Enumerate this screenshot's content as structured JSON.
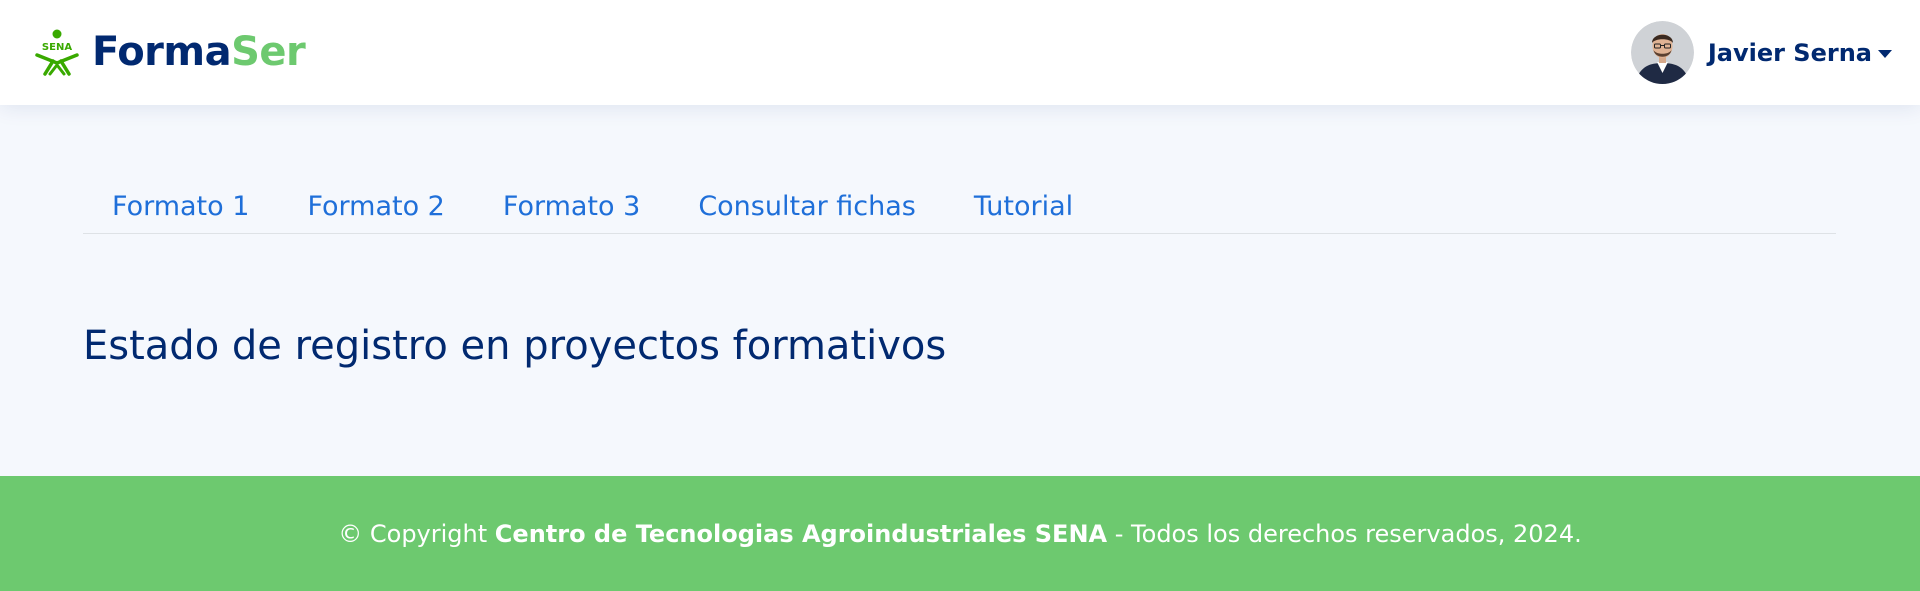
{
  "header": {
    "logo": {
      "mark_text": "SENA",
      "brand_part1": "Forma",
      "brand_part2": "Ser",
      "color_primary": "#012970",
      "color_accent": "#6dc96f",
      "icon": "sena-logo-icon"
    },
    "user": {
      "name": "Javier Serna",
      "avatar_icon": "user-avatar",
      "dropdown_icon": "caret-down-icon"
    }
  },
  "tabs": [
    {
      "label": "Formato 1"
    },
    {
      "label": "Formato 2"
    },
    {
      "label": "Formato 3"
    },
    {
      "label": "Consultar fichas"
    },
    {
      "label": "Tutorial"
    }
  ],
  "main": {
    "title": "Estado de registro en proyectos formativos"
  },
  "footer": {
    "prefix": "© Copyright",
    "org": "Centro de Tecnologias Agroindustriales SENA",
    "suffix": "- Todos los derechos reservados, 2024.",
    "background_color": "#6dc96f"
  },
  "colors": {
    "page_background": "#f5f8fd",
    "header_background": "#ffffff",
    "tab_link": "#1f6fd9",
    "title_text": "#012970"
  }
}
